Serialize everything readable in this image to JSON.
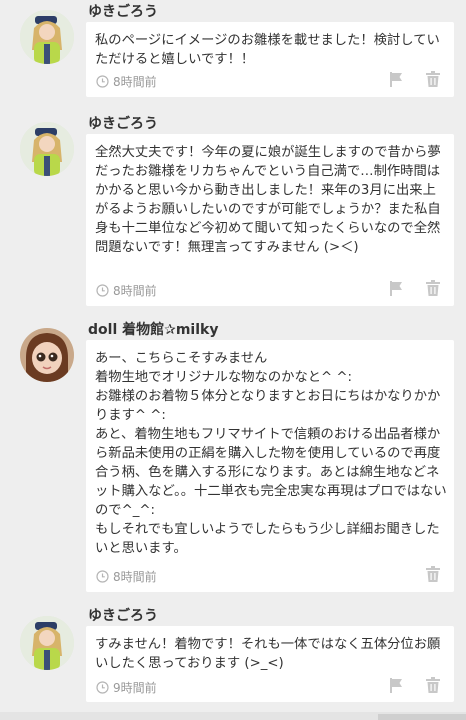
{
  "comments": [
    {
      "author": "ゆきごろう",
      "avatar_icon": "doll-avatar-icon",
      "body": "私のページにイメージのお雛様を載せました！検討していただけると嬉しいです！！",
      "time": "8時間前",
      "show_flag": true
    },
    {
      "author": "ゆきごろう",
      "avatar_icon": "doll-avatar-icon",
      "body": "全然大丈夫です！今年の夏に娘が誕生しますので昔から夢だったお雛様をリカちゃんでという自己満で…制作時間はかかると思い今から動き出しました！来年の3月に出来上がるようお願いしたいのですが可能でしょうか？また私自身も十二単位など今初めて聞いて知ったくらいなので全然問題ないです！無理言ってすみません (>＜)",
      "time": "8時間前",
      "show_flag": true
    },
    {
      "author": "doll 着物館✰milky",
      "avatar_icon": "blythe-doll-avatar-icon",
      "body": "あー、こちらこそすみません\n着物生地でオリジナルな物なのかなと^ ^:\nお雛様のお着物５体分となりますとお日にちはかなりかかります^ ^:\nあと、着物生地もフリマサイトで信頼のおける出品者様から新品未使用の正絹を購入した物を使用しているので再度合う柄、色を購入する形になります。あとは綿生地などネット購入など。。十二単衣も完全忠実な再現はプロではないので^_^:\nもしそれでも宜しいようでしたらもう少し詳細お聞きしたいと思います。",
      "time": "8時間前",
      "show_flag": false
    },
    {
      "author": "ゆきごろう",
      "avatar_icon": "doll-avatar-icon",
      "body": "すみません！着物です！それも一体ではなく五体分位お願いしたく思っております (>_<)",
      "time": "9時間前",
      "show_flag": true
    }
  ],
  "colors": {
    "background": "#eeeeee",
    "bubble": "#ffffff",
    "meta_text": "#999999",
    "icon": "#c8c8c8"
  }
}
